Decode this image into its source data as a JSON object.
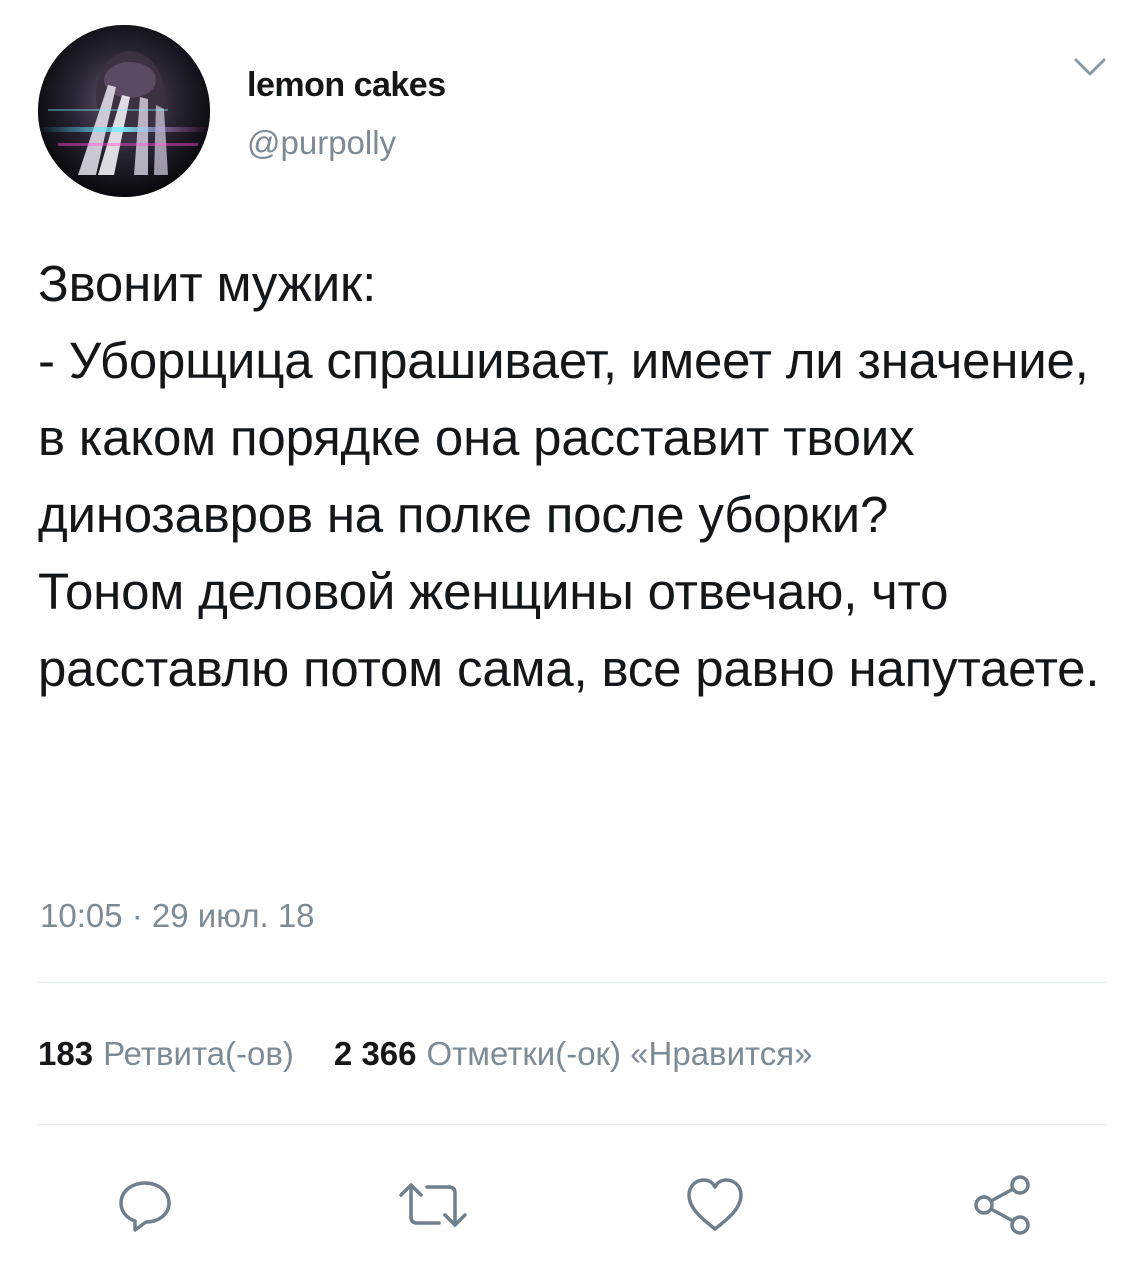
{
  "tweet": {
    "display_name": "lemon cakes",
    "handle": "@purpolly",
    "text": "Звонит мужик:\n- Уборщица спрашивает, имеет ли значение, в каком порядке она расставит твоих динозавров на полке после уборки?\nТоном деловой женщины отвечаю, что расставлю потом сама, все равно напутаете.",
    "timestamp": "10:05 · 29 июл. 18"
  },
  "stats": {
    "retweets_count": "183",
    "retweets_label": "Ретвита(-ов)",
    "likes_count": "2 366",
    "likes_label": "Отметки(-ок) «Нравится»"
  },
  "icons": {
    "menu": "chevron-down-icon",
    "reply": "reply-icon",
    "retweet": "retweet-icon",
    "like": "heart-icon",
    "share": "share-icon"
  },
  "colors": {
    "text": "#14171a",
    "secondary": "#7d8b97",
    "divider": "#e1e8ed",
    "icon": "#6f7f8d"
  }
}
